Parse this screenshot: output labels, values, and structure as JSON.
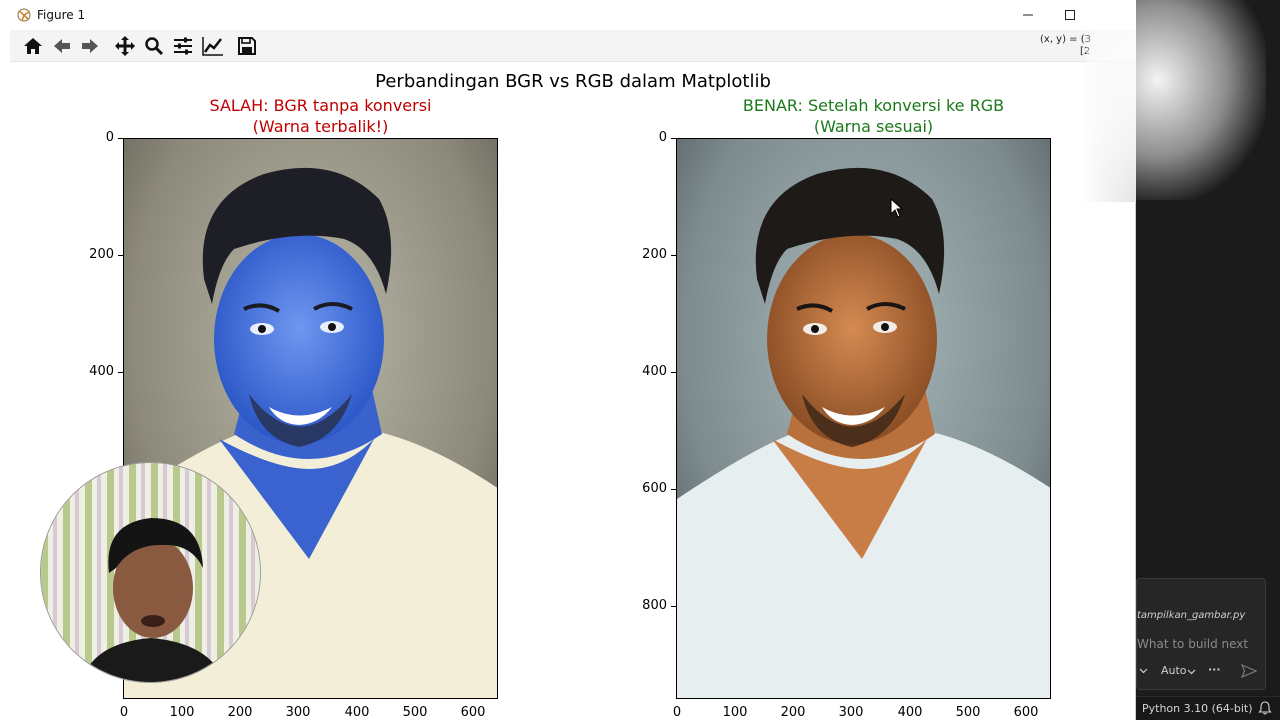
{
  "window": {
    "title": "Figure 1"
  },
  "toolbar": {
    "tools": [
      "home-icon",
      "back-arrow-icon",
      "forward-arrow-icon",
      "pan-icon",
      "zoom-icon",
      "subplots-config-icon",
      "axes-edit-icon",
      "save-icon"
    ],
    "coord_line1": "(x, y) = (3",
    "coord_line2": "[2"
  },
  "figure": {
    "suptitle": "Perbandingan BGR vs RGB dalam Matplotlib",
    "left": {
      "title_line1": "SALAH: BGR tanpa konversi",
      "title_line2": "(Warna terbalik!)",
      "title_color": "#c00000",
      "yticks": [
        "0",
        "200",
        "400"
      ],
      "xticks": [
        "0",
        "100",
        "200",
        "300",
        "400",
        "500",
        "600"
      ]
    },
    "right": {
      "title_line1": "BENAR: Setelah konversi ke RGB",
      "title_line2": "(Warna sesuai)",
      "title_color": "#1a7a1a",
      "yticks": [
        "0",
        "200",
        "400",
        "600",
        "800"
      ],
      "xticks": [
        "0",
        "100",
        "200",
        "300",
        "400",
        "500",
        "600"
      ]
    }
  },
  "ide": {
    "chat_file": "tampilkan_gambar.py",
    "chat_placeholder": "What to build next",
    "mode": "Auto",
    "more": "···",
    "python_version": "Python 3.10 (64-bit)"
  }
}
